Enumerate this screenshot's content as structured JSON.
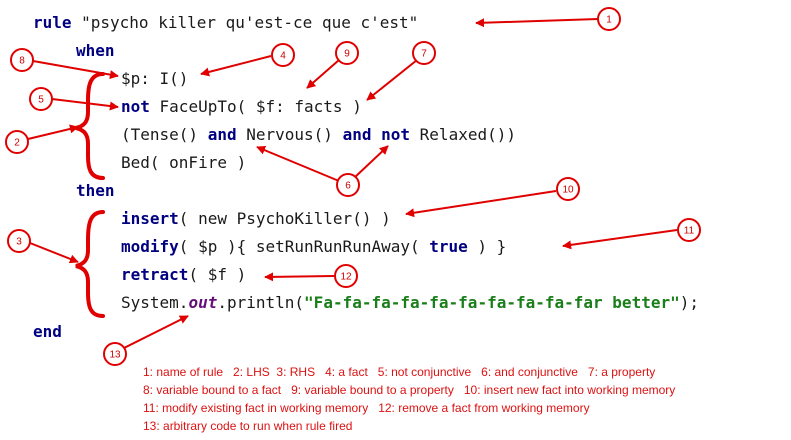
{
  "code": {
    "rule_line": {
      "keyword": "rule",
      "name": "\"psycho killer qu'est-ce que c'est\""
    },
    "when_kw": "when",
    "lhs": [
      {
        "parts": [
          {
            "t": "$p: I()"
          }
        ]
      },
      {
        "parts": [
          {
            "t": "not",
            "k": "kw"
          },
          {
            "t": " FaceUpTo( $f: facts )"
          }
        ]
      },
      {
        "parts": [
          {
            "t": "(Tense() "
          },
          {
            "t": "and",
            "k": "kw"
          },
          {
            "t": " Nervous() "
          },
          {
            "t": "and",
            "k": "kw"
          },
          {
            "t": " "
          },
          {
            "t": "not",
            "k": "kw"
          },
          {
            "t": " Relaxed())"
          }
        ]
      },
      {
        "parts": [
          {
            "t": "Bed( onFire )"
          }
        ]
      }
    ],
    "then_kw": "then",
    "rhs": [
      {
        "parts": [
          {
            "t": "insert",
            "k": "kw"
          },
          {
            "t": "( new PsychoKiller() )"
          }
        ]
      },
      {
        "parts": [
          {
            "t": "modify",
            "k": "kw"
          },
          {
            "t": "( $p ){ setRunRunRunAway( "
          },
          {
            "t": "true",
            "k": "kw"
          },
          {
            "t": " ) }"
          }
        ]
      },
      {
        "parts": [
          {
            "t": "retract",
            "k": "kw"
          },
          {
            "t": "( $f )"
          }
        ]
      },
      {
        "parts": [
          {
            "t": "System."
          },
          {
            "t": "out",
            "k": "out"
          },
          {
            "t": ".println("
          },
          {
            "t": "\"Fa-fa-fa-fa-fa-fa-fa-fa-fa-far better\"",
            "k": "str"
          },
          {
            "t": ");"
          }
        ]
      }
    ],
    "end_kw": "end"
  },
  "markers": [
    "1",
    "2",
    "3",
    "4",
    "5",
    "6",
    "7",
    "8",
    "9",
    "10",
    "11",
    "12",
    "13"
  ],
  "legend": [
    "1: name of rule   2: LHS  3: RHS   4: a fact   5: not conjunctive   6: and conjunctive   7: a property",
    "8: variable bound to a fact   9: variable bound to a property   10: insert new fact into working memory",
    "11: modify existing fact in working memory   12: remove a fact from working memory",
    "13: arbitrary code to run when rule fired"
  ],
  "colors": {
    "annotation": "#e00000",
    "keyword": "#000080",
    "string": "#1a7f1a",
    "field": "#660e7a"
  }
}
